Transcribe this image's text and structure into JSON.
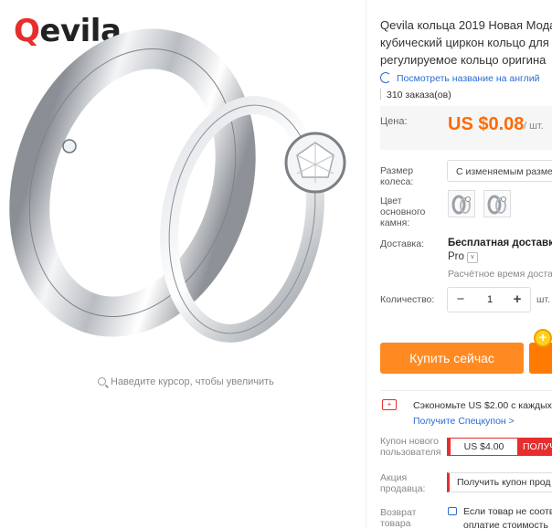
{
  "brand": {
    "logo_q": "Q",
    "logo_rest": "evila"
  },
  "gallery": {
    "zoom_hint": "Наведите курсор, чтобы увеличить"
  },
  "product": {
    "title_lines": [
      "Qevila кольца 2019 Новая Мода",
      "кубический циркон кольцо для",
      "регулируемое кольцо оригина"
    ],
    "translate_link": "Посмотреть название на англий",
    "orders": "310 заказа(ов)"
  },
  "price": {
    "label": "Цена:",
    "value": "US $0.08",
    "unit": "/ шт."
  },
  "options": {
    "size_label_lines": [
      "Размер",
      "колеса:"
    ],
    "size_value": "С изменяемым разме",
    "color_label_lines": [
      "Цвет",
      "основного",
      "камня:"
    ]
  },
  "shipping": {
    "label": "Доставка:",
    "title": "Бесплатная доставка",
    "pro": "Pro",
    "time": "Расчётное время доста"
  },
  "quantity": {
    "label": "Количество:",
    "minus": "−",
    "value": "1",
    "plus": "+",
    "unit": "шт."
  },
  "actions": {
    "buy_now": "Купить сейчас",
    "coin_glyph": "+"
  },
  "promo": {
    "save_text": "Сэкономьте US $2.00 с каждых",
    "save_link": "Получите Спецкупон >",
    "new_user_label_lines": [
      "Купон нового",
      "пользователя"
    ],
    "coupon_value": "US $4.00",
    "coupon_get": "ПОЛУЧ",
    "seller_label_lines": [
      "Акция",
      "продавца:"
    ],
    "seller_coupon": "Получить купон прод",
    "return_label_lines": [
      "Возврат",
      "товара"
    ],
    "return_text_lines": [
      "Если товар не соотв",
      "оплатие стоимость"
    ]
  },
  "colors": {
    "accent_orange": "#ff6a00",
    "buy_button": "#ff8a21",
    "link_blue": "#2b6bd6",
    "red": "#e62e2e"
  }
}
